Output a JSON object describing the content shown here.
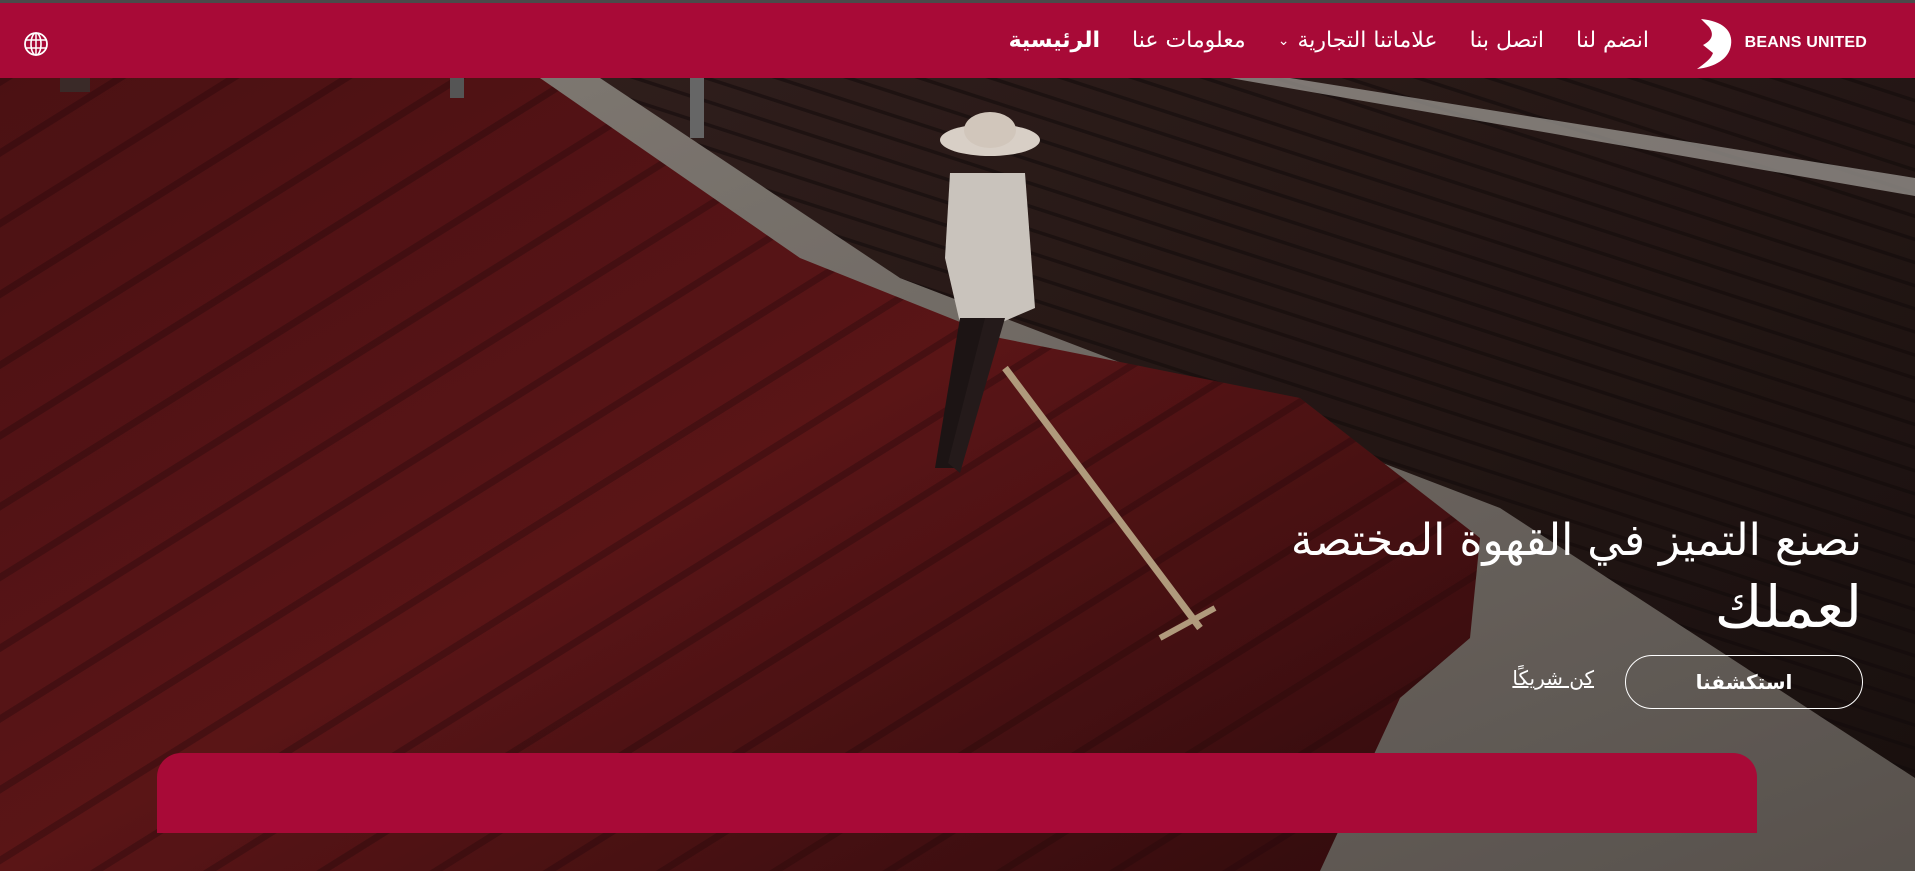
{
  "header": {
    "brand_name": "BEANS UNITED",
    "nav": [
      {
        "label": "الرئيسية",
        "active": true
      },
      {
        "label": "معلومات عنا",
        "active": false
      },
      {
        "label": "علاماتنا التجارية",
        "active": false,
        "has_dropdown": true
      },
      {
        "label": "اتصل بنا",
        "active": false
      },
      {
        "label": "انضم لنا",
        "active": false
      }
    ],
    "dropdown_chevron": "⌄",
    "language_icon": "globe-icon"
  },
  "hero": {
    "headline_line1": "نصنع التميز في القهوة المختصة",
    "headline_line2": "لعملك",
    "primary_cta": "استكشفنا",
    "secondary_cta": "كن شريكًا",
    "background_image": "coffee-drying-beds-photo"
  },
  "colors": {
    "brand": "#a80a37",
    "text": "#ffffff"
  }
}
